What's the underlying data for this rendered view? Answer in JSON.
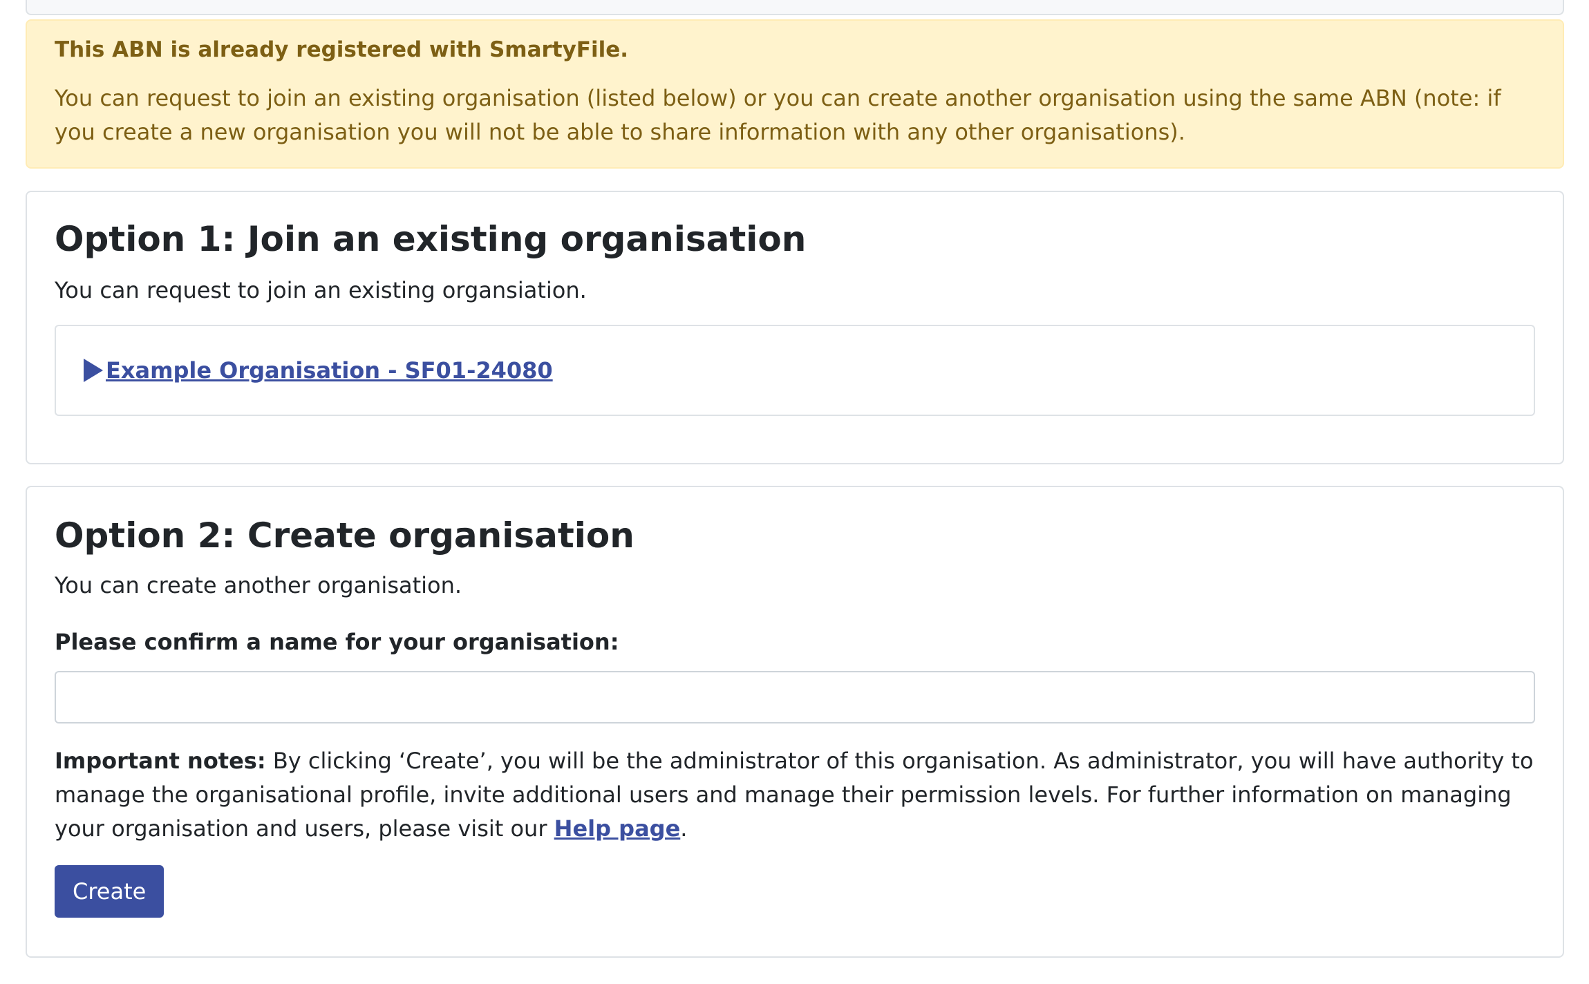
{
  "alert": {
    "title": "This ABN is already registered with SmartyFile.",
    "body": "You can request to join an existing organisation (listed below) or you can create another organisation using the same ABN (note: if you create a new organisation you will not be able to share information with any other organisations)."
  },
  "option1": {
    "heading": "Option 1: Join an existing organisation",
    "description": "You can request to join an existing organsiation.",
    "organisations": [
      {
        "label": "Example Organisation - SF01-24080",
        "icon": "play-triangle-icon"
      }
    ]
  },
  "option2": {
    "heading": "Option 2: Create organisation",
    "description": "You can create another organisation.",
    "name_label": "Please confirm a name for your organisation:",
    "name_value": "",
    "notes_bold": "Important notes:",
    "notes_text": " By clicking ‘Create’, you will be the administrator of this organisation. As administrator, you will have authority to manage the organisational profile, invite additional users and manage their permission levels. For further information on managing your organisation and users, please visit our ",
    "help_link": "Help page",
    "notes_end": ".",
    "create_label": "Create"
  },
  "colors": {
    "accent": "#3b4fa0",
    "alert_bg": "#fff3cd",
    "alert_text": "#7d5f14"
  }
}
